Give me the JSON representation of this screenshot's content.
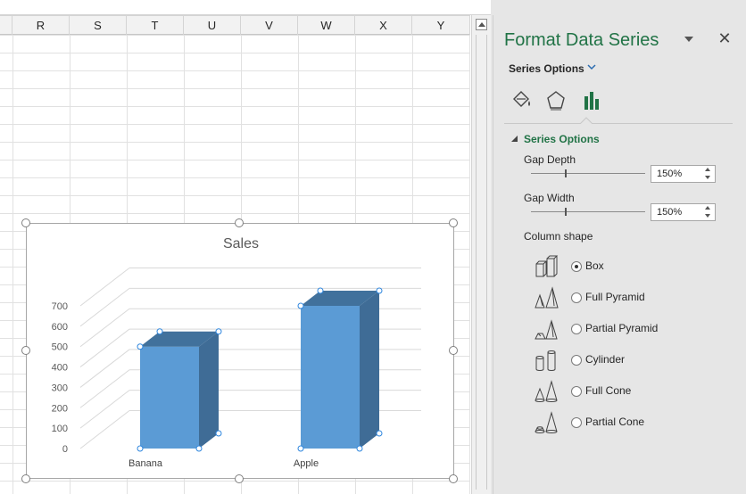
{
  "sheet": {
    "columns": [
      "R",
      "S",
      "T",
      "U",
      "V",
      "W",
      "X",
      "Y"
    ]
  },
  "chart_data": {
    "type": "bar",
    "title": "Sales",
    "categories": [
      "Banana",
      "Apple"
    ],
    "values": [
      500,
      700
    ],
    "ylim": [
      0,
      700
    ],
    "yticks": [
      "0",
      "100",
      "200",
      "300",
      "400",
      "500",
      "600",
      "700"
    ],
    "grid": true,
    "legend": "none",
    "bar_color": "#5b9bd5",
    "bar_side_color": "#3f6c96",
    "bar_top_color": "#41719c"
  },
  "pane": {
    "title": "Format Data Series",
    "close_glyph": "✕",
    "series_dropdown": "Series Options",
    "section_title": "Series Options",
    "gap_depth": {
      "label": "Gap Depth",
      "value": "150%",
      "level_percent": 30
    },
    "gap_width": {
      "label": "Gap Width",
      "value": "150%",
      "level_percent": 30
    },
    "column_shape_label": "Column shape",
    "shapes": [
      {
        "label": "Box",
        "checked": true,
        "icon": "box-shape-icon"
      },
      {
        "label": "Full Pyramid",
        "checked": false,
        "icon": "full-pyramid-icon"
      },
      {
        "label": "Partial Pyramid",
        "checked": false,
        "icon": "partial-pyramid-icon"
      },
      {
        "label": "Cylinder",
        "checked": false,
        "icon": "cylinder-icon"
      },
      {
        "label": "Full Cone",
        "checked": false,
        "icon": "full-cone-icon"
      },
      {
        "label": "Partial Cone",
        "checked": false,
        "icon": "partial-cone-icon"
      }
    ],
    "accent_color": "#217346",
    "tabs": [
      "fill-line-icon",
      "effects-icon",
      "series-options-icon"
    ]
  }
}
